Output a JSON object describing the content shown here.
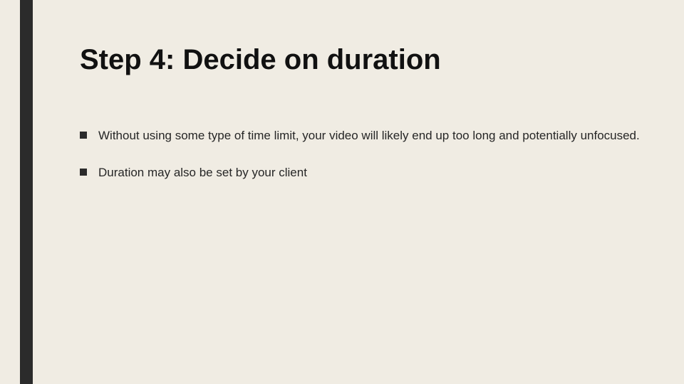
{
  "slide": {
    "title": "Step 4: Decide on duration",
    "bullets": [
      "Without using some type of time limit, your video will likely end up too long and potentially unfocused.",
      "Duration may also be set by your client"
    ]
  },
  "theme": {
    "background": "#f0ece3",
    "stripe": "#2b2b2b",
    "text": "#1a1a1a"
  }
}
